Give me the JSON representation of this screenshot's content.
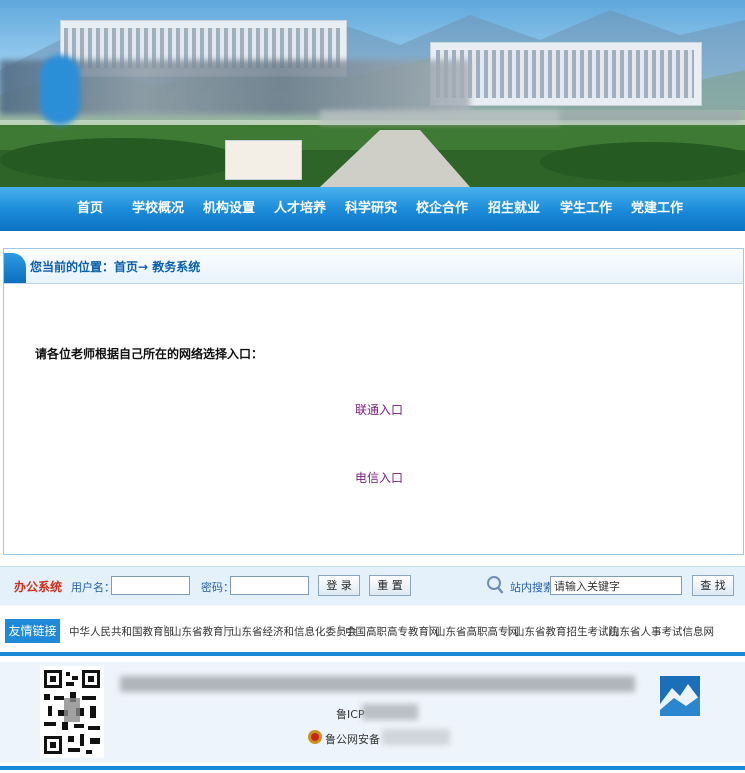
{
  "nav": {
    "items": [
      "首页",
      "学校概况",
      "机构设置",
      "人才培养",
      "科学研究",
      "校企合作",
      "招生就业",
      "学生工作",
      "党建工作"
    ]
  },
  "breadcrumb": {
    "text": "您当前的位置：首页→ 教务系统"
  },
  "content": {
    "prompt": "请各位老师根据自己所在的网络选择入口：",
    "entries": [
      "联通入口",
      "电信入口"
    ]
  },
  "login": {
    "section_label": "办公系统",
    "username_label": "用户名：",
    "password_label": "密码：",
    "login_button": "登 录",
    "reset_button": "重 置",
    "search_label": "站内搜索",
    "search_value": "请输入关键字",
    "search_button": "查 找"
  },
  "friend_links": {
    "label": "友情链接",
    "items": [
      "中华人民共和国教育部",
      "山东省教育厅",
      "山东省经济和信息化委员会",
      "中国高职高专教育网",
      "山东省高职高专网",
      "山东省教育招生考试院",
      "山东省人事考试信息网"
    ]
  },
  "footer": {
    "icp": "鲁ICP",
    "police": "鲁公网安备"
  },
  "colors": {
    "nav": "#1a8ad8",
    "accent": "#2560a8",
    "entry_link": "#7a1f84",
    "section_red": "#d0301c"
  }
}
